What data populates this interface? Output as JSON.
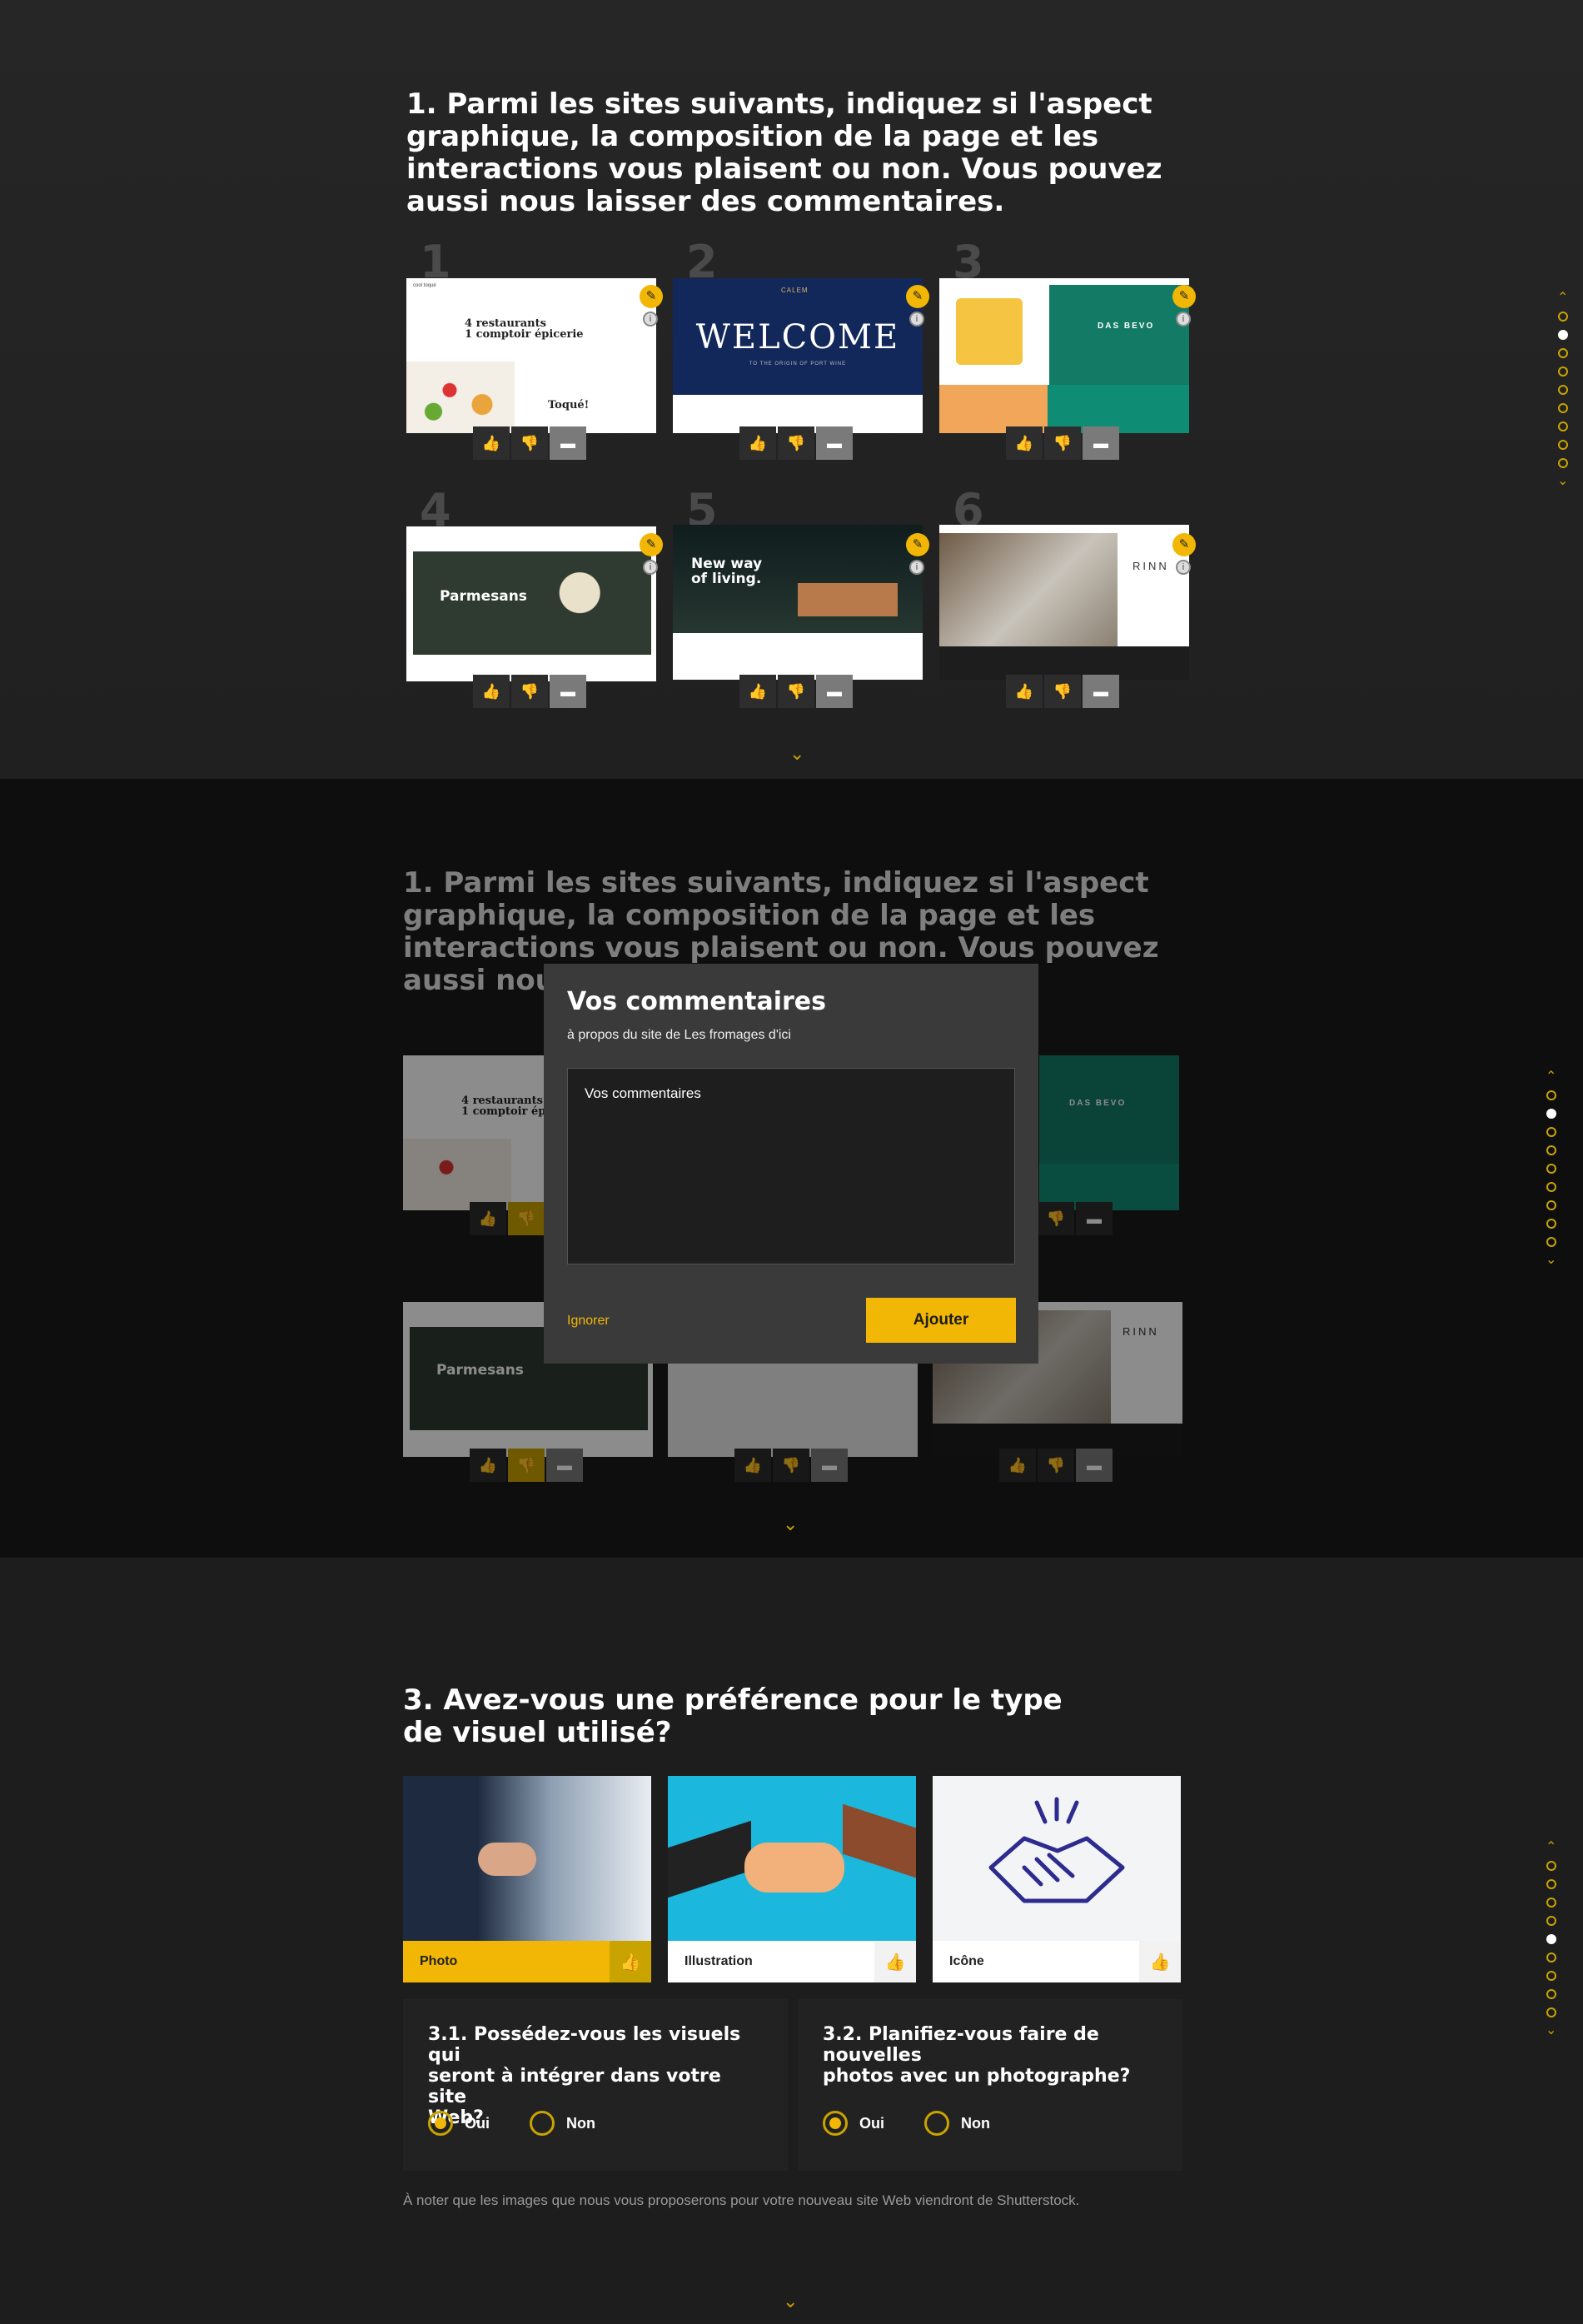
{
  "question1": {
    "title_lines": [
      "1. Parmi les sites suivants, indiquez si l'aspect",
      "graphique, la composition de la page et les",
      "interactions vous plaisent ou non. Vous pouvez",
      "aussi nous laisser des commentaires."
    ],
    "sites": [
      {
        "number": "1",
        "heading": "4 restaurants\n1 comptoir épicerie",
        "sign": "Toqué!",
        "logo": "cool toqué"
      },
      {
        "number": "2",
        "heading": "WELCOME",
        "sub": "TO THE ORIGIN OF PORT WINE",
        "logo": "CALEM"
      },
      {
        "number": "3",
        "heading": "DAS BEVO"
      },
      {
        "number": "4",
        "heading": "Parmesans"
      },
      {
        "number": "5",
        "heading": "New way\nof living."
      },
      {
        "number": "6",
        "heading": "RINN"
      }
    ],
    "vote_icons": {
      "like": "thumbs-up-icon",
      "dislike": "thumbs-down-icon",
      "comment": "comment-icon"
    }
  },
  "modal": {
    "title": "Vos commentaires",
    "subtitle": "à propos du site de Les fromages d'ici",
    "textarea_placeholder": "Vos commentaires",
    "ignore_label": "Ignorer",
    "add_label": "Ajouter"
  },
  "question3": {
    "title_lines": [
      "3. Avez-vous une préférence pour le type",
      "de visuel utilisé?"
    ],
    "visuals": [
      {
        "label": "Photo",
        "selected": true
      },
      {
        "label": "Illustration",
        "selected": false
      },
      {
        "label": "Icône",
        "selected": false
      }
    ],
    "sub1": {
      "title_lines": [
        "3.1. Possédez-vous les visuels qui",
        "seront à intégrer dans votre site",
        "Web?"
      ],
      "options": [
        "Oui",
        "Non"
      ],
      "selected": "Oui"
    },
    "sub2": {
      "title_lines": [
        "3.2. Planifiez-vous faire de nouvelles",
        "photos avec un photographe?"
      ],
      "options": [
        "Oui",
        "Non"
      ],
      "selected": "Oui"
    },
    "note": "À noter que les images que nous vous proposerons pour votre nouveau site Web viendront de Shutterstock."
  },
  "nav": {
    "dots_count": 9,
    "active_panel1": 2,
    "active_panel2": 2,
    "active_panel3": 5
  },
  "colors": {
    "accent": "#f2b705",
    "bg_dark": "#1d1d1d",
    "panel": "#3a3a3a"
  }
}
